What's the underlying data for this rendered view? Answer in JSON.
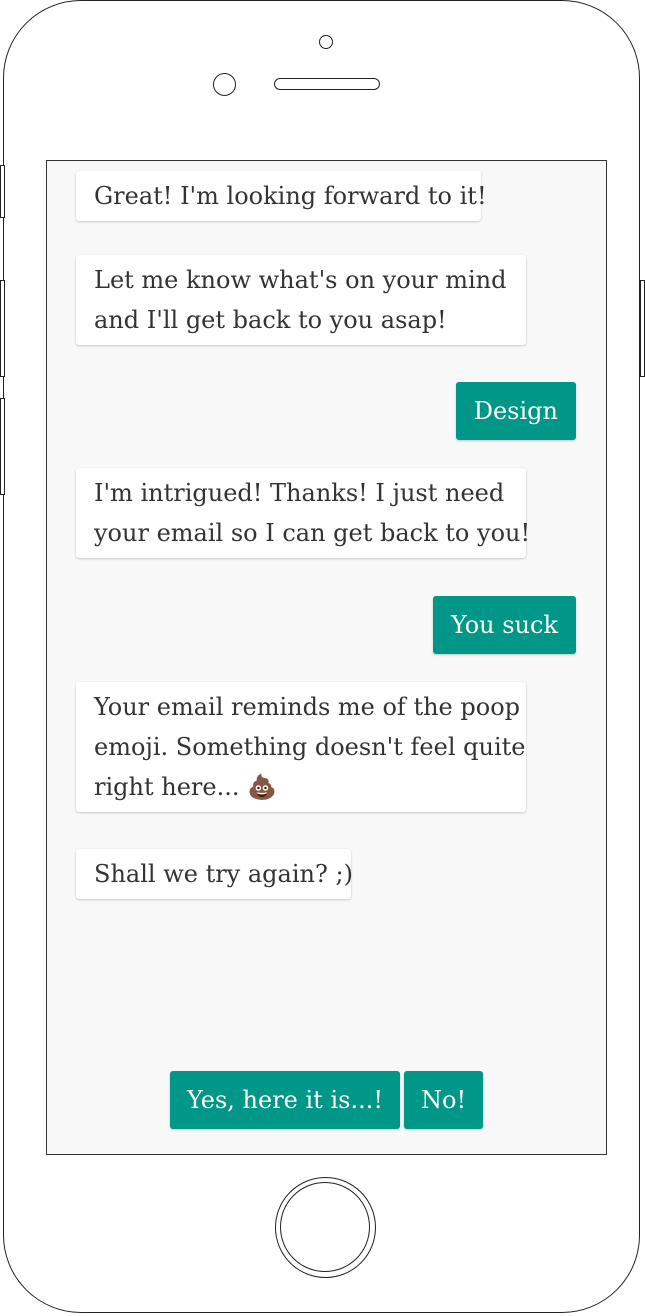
{
  "chat": {
    "messages": [
      {
        "from": "bot",
        "text": "Great! I'm looking forward to it!"
      },
      {
        "from": "bot",
        "lines": [
          "Let me know what's on your mind",
          "and I'll get back to you asap!"
        ]
      },
      {
        "from": "user",
        "text": "Design"
      },
      {
        "from": "bot",
        "lines": [
          "I'm intrigued! Thanks! I just need",
          "your email so I can get back to you!"
        ]
      },
      {
        "from": "user",
        "text": "You suck"
      },
      {
        "from": "bot",
        "lines": [
          "Your email reminds me of the poop",
          "emoji. Something doesn't feel quite",
          "right here... 💩"
        ]
      },
      {
        "from": "bot",
        "text": "Shall we try again? ;)"
      }
    ]
  },
  "choices": {
    "yes_label": "Yes, here it is...!",
    "no_label": "No!"
  },
  "colors": {
    "accent": "#009688",
    "screen_bg": "#f8f8f8",
    "bubble_bg": "#ffffff",
    "bubble_text": "#333333"
  }
}
